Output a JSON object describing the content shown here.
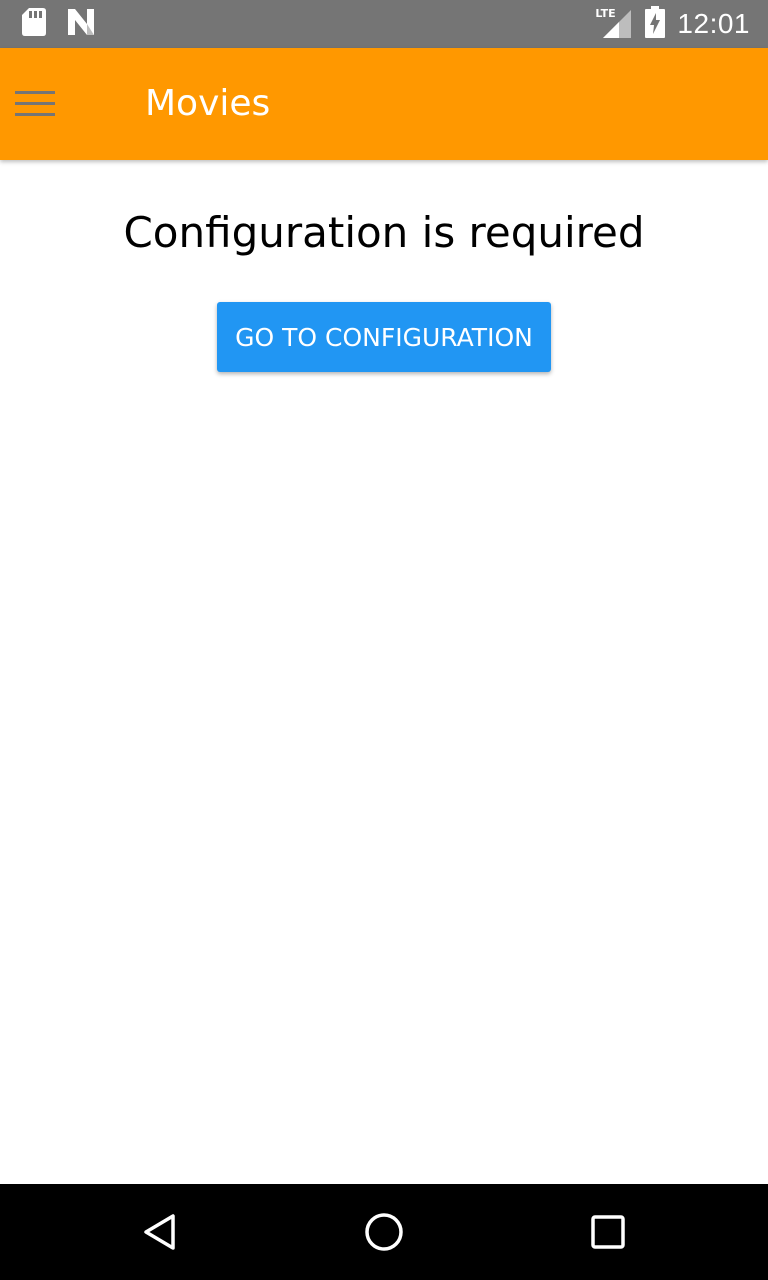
{
  "status_bar": {
    "time": "12:01",
    "network_label": "LTE",
    "icons": [
      "sd-card-icon",
      "n-notification-icon",
      "lte-signal-icon",
      "battery-charging-icon"
    ]
  },
  "app_bar": {
    "title": "Movies",
    "menu_icon": "hamburger-menu-icon",
    "color": "#ff9800"
  },
  "content": {
    "message": "Configuration is required",
    "button_label": "GO TO CONFIGURATION",
    "button_color": "#2196f3"
  },
  "nav_bar": {
    "icons": [
      "back-icon",
      "home-icon",
      "recents-icon"
    ]
  }
}
